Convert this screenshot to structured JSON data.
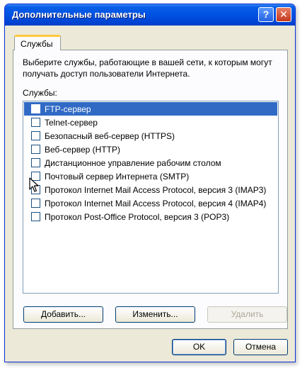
{
  "window": {
    "title": "Дополнительные параметры",
    "help_label": "?",
    "close_label": "✕"
  },
  "tabs": [
    {
      "label": "Службы",
      "active": true
    }
  ],
  "panel": {
    "description": "Выберите службы, работающие в вашей сети, к которым могут получать доступ пользователи Интернета.",
    "list_label": "Службы:"
  },
  "services": [
    {
      "label": "FTP-сервер",
      "checked": false,
      "selected": true
    },
    {
      "label": "Telnet-сервер",
      "checked": false,
      "selected": false
    },
    {
      "label": "Безопасный веб-сервер (HTTPS)",
      "checked": false,
      "selected": false
    },
    {
      "label": "Веб-сервер (HTTP)",
      "checked": false,
      "selected": false
    },
    {
      "label": "Дистанционное управление рабочим столом",
      "checked": false,
      "selected": false
    },
    {
      "label": "Почтовый сервер Интернета (SMTP)",
      "checked": false,
      "selected": false
    },
    {
      "label": "Протокол Internet Mail Access Protocol, версия 3 (IMAP3)",
      "checked": false,
      "selected": false
    },
    {
      "label": "Протокол Internet Mail Access Protocol, версия 4 (IMAP4)",
      "checked": false,
      "selected": false
    },
    {
      "label": "Протокол Post-Office Protocol, версия 3 (POP3)",
      "checked": false,
      "selected": false
    }
  ],
  "buttons": {
    "add": "Добавить...",
    "edit": "Изменить...",
    "delete": "Удалить",
    "ok": "OK",
    "cancel": "Отмена"
  },
  "colors": {
    "selection": "#316ac5",
    "titlebar": "#0054e3",
    "dialog_bg": "#ece9d8"
  }
}
